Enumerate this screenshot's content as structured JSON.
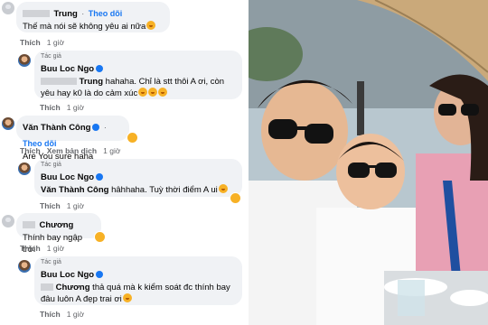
{
  "comments": {
    "c1": {
      "name": "Trung",
      "follow": "Theo dõi",
      "text": "Thế mà nói sẽ không yêu ai nữa",
      "like": "Thích",
      "time": "1 giờ"
    },
    "r1": {
      "badge": "Tác giả",
      "name": "Buu Loc Ngo",
      "tag": "Trung",
      "text": " hahaha. Chỉ là stt thôi A ơi, còn yêu hay k0 là do cảm xúc",
      "like": "Thích",
      "time": "1 giờ"
    },
    "c2": {
      "name": "Văn Thành Công",
      "follow": "Theo dõi",
      "text": "Are You sure haha",
      "like": "Thích",
      "translate": "Xem bản dịch",
      "time": "1 giờ"
    },
    "r2": {
      "badge": "Tác giả",
      "name": "Buu Loc Ngo",
      "tag": "Văn Thành Công",
      "text": " hâhhaha. Tuỳ thời điểm A ui",
      "like": "Thích",
      "time": "1 giờ"
    },
    "c3": {
      "name": "Chương",
      "text": "Thính bay ngập trời",
      "like": "Thích",
      "time": "1 giờ"
    },
    "r3": {
      "badge": "Tác giả",
      "name": "Buu Loc Ngo",
      "tag": "Chương",
      "text": " thả quá mà k kiểm soát đc thính bay đâu luôn A đẹp trai ơi",
      "like": "Thích",
      "time": "1 giờ"
    }
  },
  "colors": {
    "link": "#1877f2",
    "bubble": "#f0f2f5",
    "meta": "#65676b"
  }
}
